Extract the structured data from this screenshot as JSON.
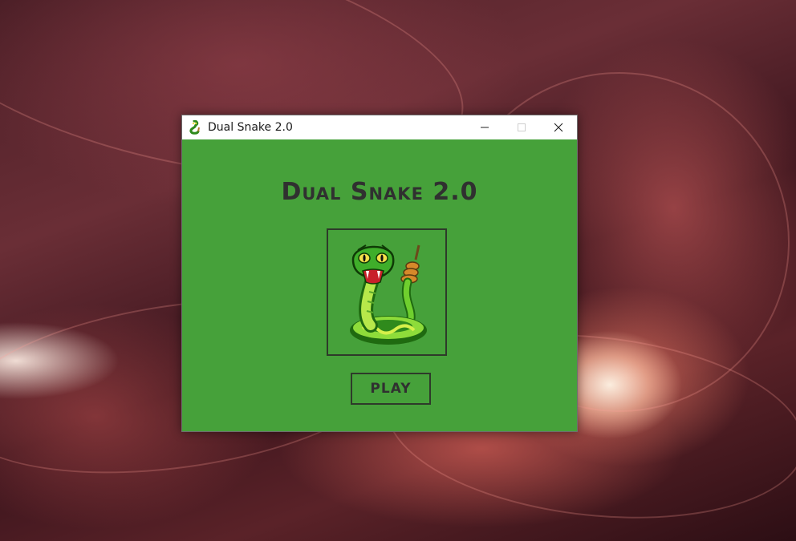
{
  "window": {
    "title": "Dual Snake 2.0",
    "icon": "snake-icon",
    "controls": {
      "minimize": "minimize-icon",
      "maximize": "maximize-icon",
      "close": "close-icon"
    }
  },
  "game": {
    "title": "Dual Snake 2.0",
    "logo": "rattlesnake-mascot",
    "play_label": "PLAY"
  },
  "colors": {
    "client_background": "#46a13a",
    "title_text": "#303030",
    "frame_border": "#2e3a2a"
  }
}
